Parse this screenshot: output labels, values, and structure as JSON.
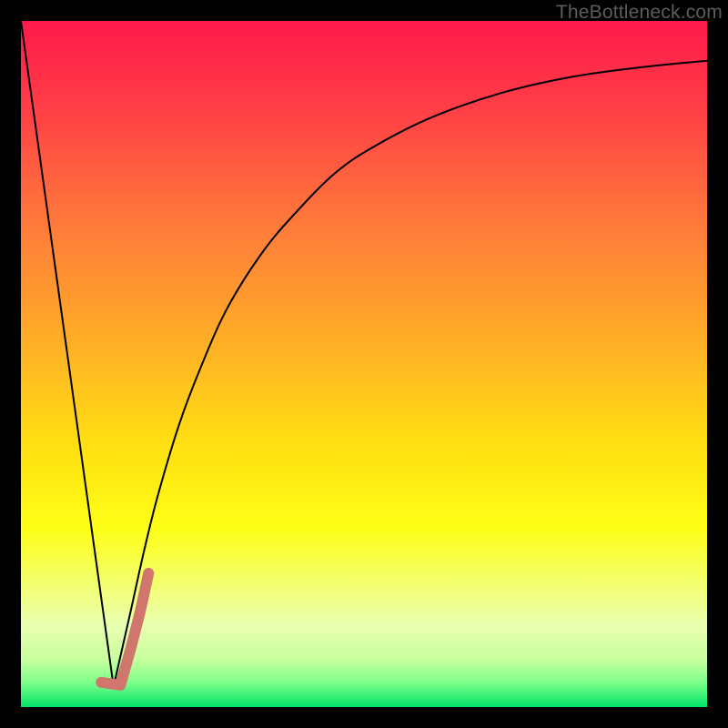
{
  "watermark": "TheBottleneck.com",
  "chart_data": {
    "type": "line",
    "title": "",
    "xlabel": "",
    "ylabel": "",
    "xlim": [
      0,
      100
    ],
    "ylim": [
      0,
      100
    ],
    "grid": false,
    "legend": false,
    "annotations": [],
    "background_gradient": {
      "stops": [
        {
          "offset": 0.0,
          "color": "#ff1a4b"
        },
        {
          "offset": 0.12,
          "color": "#ff3c47"
        },
        {
          "offset": 0.3,
          "color": "#ff7b3a"
        },
        {
          "offset": 0.48,
          "color": "#ffb225"
        },
        {
          "offset": 0.62,
          "color": "#ffe011"
        },
        {
          "offset": 0.74,
          "color": "#feff17"
        },
        {
          "offset": 0.82,
          "color": "#f3ff6e"
        },
        {
          "offset": 0.88,
          "color": "#e9ffb0"
        },
        {
          "offset": 0.93,
          "color": "#c8ff9e"
        },
        {
          "offset": 0.965,
          "color": "#7bff8a"
        },
        {
          "offset": 1.0,
          "color": "#00e566"
        }
      ]
    },
    "series": [
      {
        "name": "left-line",
        "stroke": "#000000",
        "stroke_width": 2,
        "x": [
          0,
          13.5
        ],
        "y": [
          100,
          3
        ]
      },
      {
        "name": "right-curve",
        "stroke": "#000000",
        "stroke_width": 2,
        "x": [
          13.5,
          16,
          18,
          20,
          23,
          26,
          30,
          35,
          40,
          46,
          52,
          60,
          70,
          80,
          90,
          100
        ],
        "y": [
          3,
          14,
          23,
          31,
          41,
          49,
          58,
          66,
          72,
          78,
          82,
          86,
          89.5,
          91.8,
          93.2,
          94.2
        ]
      },
      {
        "name": "marker-hook",
        "stroke": "#d1766c",
        "stroke_width": 12,
        "linecap": "round",
        "x": [
          11.7,
          14.5,
          16.0,
          17.4,
          18.6
        ],
        "y": [
          3.6,
          3.2,
          8.5,
          14.0,
          19.5
        ]
      }
    ]
  }
}
